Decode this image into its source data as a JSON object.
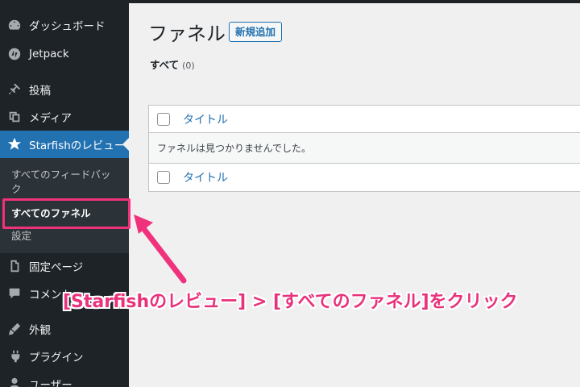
{
  "sidebar": {
    "items": [
      {
        "label": "ダッシュボード",
        "icon": "dashboard-icon"
      },
      {
        "label": "Jetpack",
        "icon": "jetpack-icon"
      },
      {
        "label": "投稿",
        "icon": "pin-icon"
      },
      {
        "label": "メディア",
        "icon": "media-icon"
      },
      {
        "label": "Starfishのレビュー",
        "icon": "star-icon"
      },
      {
        "label": "固定ページ",
        "icon": "page-icon"
      },
      {
        "label": "コメント",
        "icon": "comment-icon"
      },
      {
        "label": "外観",
        "icon": "appearance-icon"
      },
      {
        "label": "プラグイン",
        "icon": "plugin-icon"
      },
      {
        "label": "ユーザー",
        "icon": "user-icon"
      }
    ],
    "submenu": [
      {
        "label": "すべてのフィードバッ"
      },
      {
        "label": "ク"
      },
      {
        "label": "すべてのファネル"
      },
      {
        "label": "設定"
      }
    ]
  },
  "main": {
    "title": "ファネル",
    "add_new_label": "新規追加",
    "filter": {
      "label": "すべて",
      "count": "(0)"
    },
    "table": {
      "header_title": "タイトル",
      "empty_message": "ファネルは見つかりませんでした。",
      "footer_title": "タイトル"
    }
  },
  "annotation": {
    "callout": "[Starfishのレビュー] > [すべてのファネル]をクリック",
    "color": "#e8327c"
  },
  "colors": {
    "sidebar_bg": "#1d2327",
    "active_bg": "#2271b1",
    "link": "#2271b1"
  }
}
